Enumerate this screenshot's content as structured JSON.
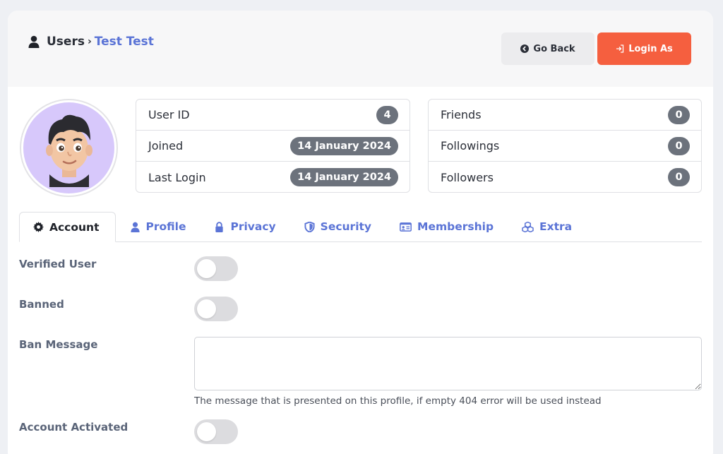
{
  "breadcrumb": {
    "root": "Users",
    "separator": "›",
    "current": "Test Test"
  },
  "actions": {
    "back_label": "Go Back",
    "login_label": "Login As"
  },
  "stats_left": [
    {
      "label": "User ID",
      "value": "4"
    },
    {
      "label": "Joined",
      "value": "14 January 2024"
    },
    {
      "label": "Last Login",
      "value": "14 January 2024"
    }
  ],
  "stats_right": [
    {
      "label": "Friends",
      "value": "0"
    },
    {
      "label": "Followings",
      "value": "0"
    },
    {
      "label": "Followers",
      "value": "0"
    }
  ],
  "tabs": [
    {
      "label": "Account",
      "icon": "gear-icon",
      "active": true
    },
    {
      "label": "Profile",
      "icon": "user-icon",
      "active": false
    },
    {
      "label": "Privacy",
      "icon": "lock-icon",
      "active": false
    },
    {
      "label": "Security",
      "icon": "shield-icon",
      "active": false
    },
    {
      "label": "Membership",
      "icon": "id-card-icon",
      "active": false
    },
    {
      "label": "Extra",
      "icon": "cubes-icon",
      "active": false
    }
  ],
  "form": {
    "verified_label": "Verified User",
    "verified_value": false,
    "banned_label": "Banned",
    "banned_value": false,
    "ban_message_label": "Ban Message",
    "ban_message_value": "",
    "ban_message_hint": "The message that is presented on this profile, if empty 404 error will be used instead",
    "activated_label": "Account Activated",
    "activated_value": false
  },
  "colors": {
    "accent": "#5b74d6",
    "login_button": "#f55f3f",
    "pill": "#6c727c",
    "avatar_bg": "#d7c8fb"
  }
}
